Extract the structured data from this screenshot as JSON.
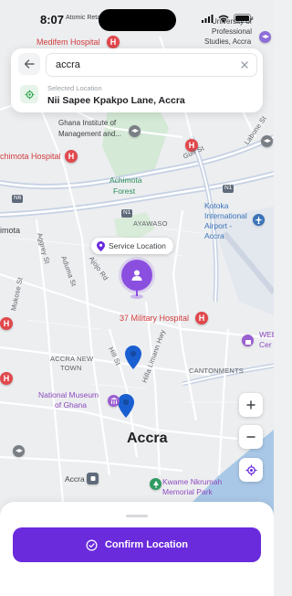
{
  "status_bar": {
    "time": "8:07"
  },
  "search": {
    "query": "accra",
    "selected_caption": "Selected Location",
    "selected_address": "Nii Sapee Kpakpo Lane, Accra"
  },
  "map": {
    "service_chip": "Service Location",
    "labels": {
      "atomic_retail": "Atomic Retail",
      "medifem": "Medifem Hospital",
      "univ1": "University of",
      "univ2": "Professional",
      "univ3": "Studies, Accra",
      "gima1": "Ghana Institute of",
      "gima2": "Management and...",
      "achimota_hosp": "chimota Hospital",
      "achimota_forest1": "Achimota",
      "achimota_forest2": "Forest",
      "gulf": "Gulf St",
      "n6": "N6",
      "n1a": "N1",
      "n1b": "N1",
      "chimota": "imota",
      "ayawaso": "AYAWASO",
      "kotoka1": "Kotoka",
      "kotoka2": "International",
      "kotoka3": "Airport -",
      "kotoka4": "Accra",
      "aggrey": "Aggrey St",
      "mukose": "Mukose St",
      "tesano": "Aduma St",
      "ajojo": "Ajojo Rd",
      "military": "37 Military Hospital",
      "hill": "Hill St",
      "limann": "Hilla Limann Hwy",
      "accra_new_town1": "ACCRA NEW",
      "accra_new_town2": "TOWN",
      "cantonments": "CANTONMENTS",
      "web1": "WEB",
      "web2": "Cer",
      "museum1": "National Museum",
      "museum2": "of Ghana",
      "accra_city": "Accra",
      "accra_small": "Accra",
      "kwame1": "Kwame Nkrumah",
      "kwame2": "Memorial Park",
      "labone": "Labone St"
    }
  },
  "bottom": {
    "confirm_label": "Confirm Location"
  },
  "colors": {
    "accent": "#6a2bdc",
    "marker": "#8b4fe0",
    "hospital": "#e0484c",
    "road": "#ffffff",
    "highway": "#c8d3e6",
    "water": "#a8c6e6",
    "park": "#cfe8d2"
  },
  "icons": [
    "back-arrow-icon",
    "clear-icon",
    "location-target-icon",
    "pin-icon",
    "person-icon",
    "zoom-in-icon",
    "zoom-out-icon",
    "my-location-icon",
    "check-circle-icon"
  ]
}
